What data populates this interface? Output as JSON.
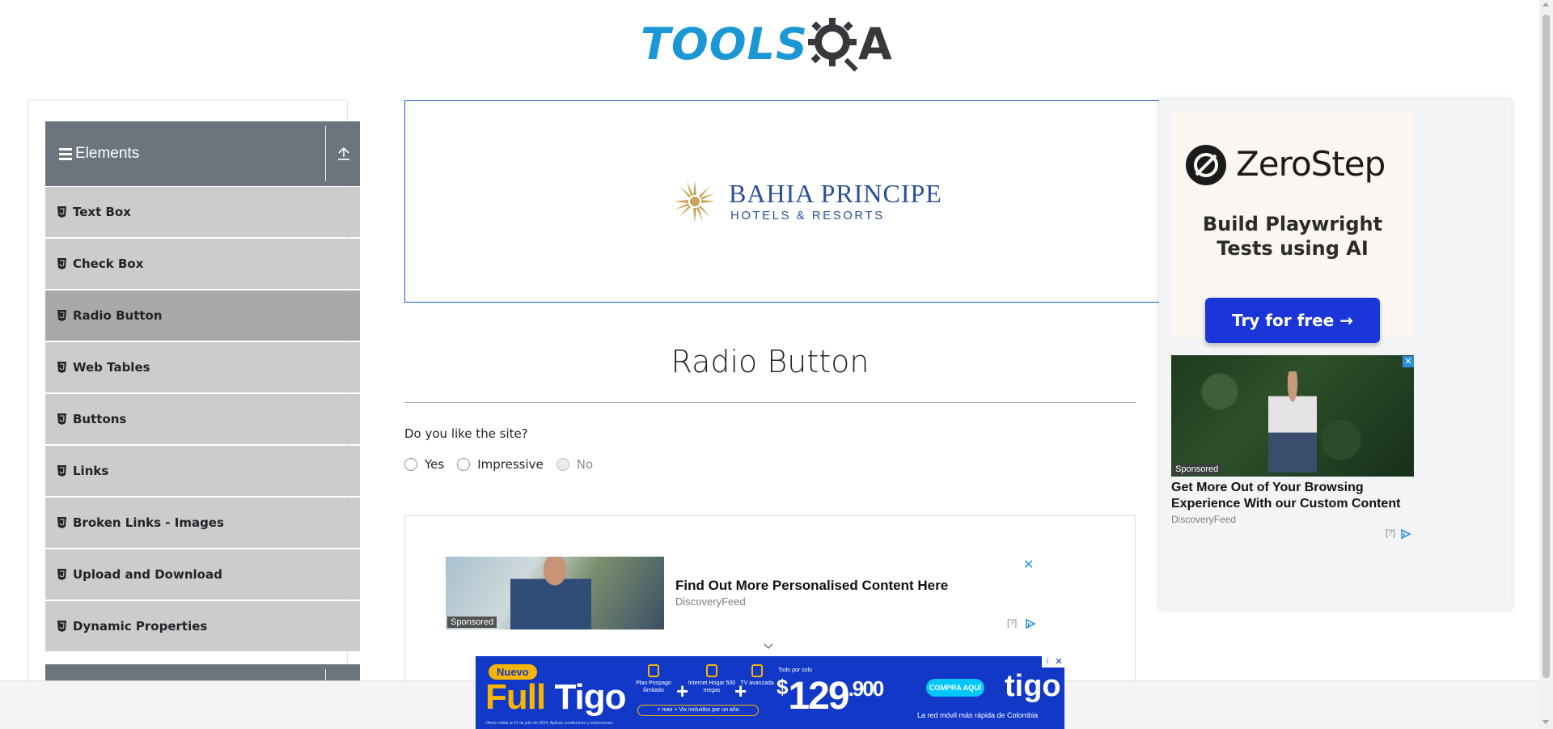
{
  "header": {
    "logo_part1": "TOOLS",
    "logo_part2": "A"
  },
  "sidebar": {
    "group_title": "Elements",
    "items": [
      {
        "label": "Text Box",
        "active": false
      },
      {
        "label": "Check Box",
        "active": false
      },
      {
        "label": "Radio Button",
        "active": true
      },
      {
        "label": "Web Tables",
        "active": false
      },
      {
        "label": "Buttons",
        "active": false
      },
      {
        "label": "Links",
        "active": false
      },
      {
        "label": "Broken Links - Images",
        "active": false
      },
      {
        "label": "Upload and Download",
        "active": false
      },
      {
        "label": "Dynamic Properties",
        "active": false
      }
    ]
  },
  "banner_ad": {
    "brand_line1": "BAHIA PRINCIPE",
    "brand_line2": "HOTELS & RESORTS"
  },
  "main": {
    "title": "Radio Button",
    "question": "Do you like the site?",
    "options": [
      {
        "label": "Yes",
        "disabled": false
      },
      {
        "label": "Impressive",
        "disabled": false
      },
      {
        "label": "No",
        "disabled": true
      }
    ]
  },
  "inline_ad": {
    "sponsored": "Sponsored",
    "headline": "Find Out More Personalised Content Here",
    "source": "DiscoveryFeed",
    "help": "[?]",
    "close": "✕"
  },
  "right_ad": {
    "brand": "ZeroStep",
    "tagline_line1": "Build Playwright",
    "tagline_line2": "Tests using AI",
    "cta": "Try for free →",
    "sponsored": "Sponsored",
    "headline": "Get More Out of Your Browsing Experience With our Custom Content",
    "source": "DiscoveryFeed",
    "help": "[?]",
    "close": "✕"
  },
  "bottom_ad": {
    "badge": "Nuevo",
    "brand_full": "Full",
    "brand_tigo": "Tigo",
    "plus_mark": "+",
    "features": [
      "Plan Pospago ilimitado",
      "Internet Hogar 500 megas",
      "TV avanzada"
    ],
    "included": "+ max + Vix incluidos por un año",
    "price_prefix": "Todo por solo",
    "currency": "$",
    "price_main": "129",
    "price_cents": ".900",
    "cta": "COMPRA AQUÍ",
    "logo": "tigo",
    "slogan": "La red móvil más rápida de Colombia",
    "fine_print": "Oferta válida al 31 de julio de 2024. Aplican condiciones y restricciones.",
    "info": "i",
    "close": "✕"
  }
}
